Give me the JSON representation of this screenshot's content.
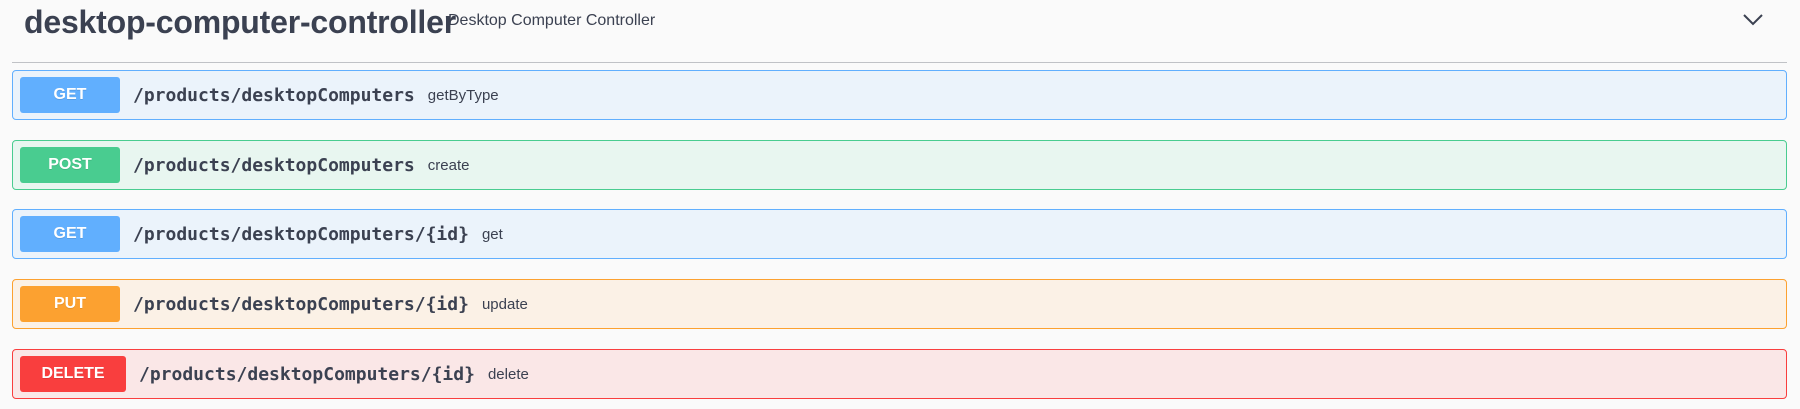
{
  "tag": {
    "name": "desktop-computer-controller",
    "description": "Desktop Computer Controller",
    "toggle_icon": "chevron-down-icon"
  },
  "operations": [
    {
      "method": "GET",
      "path": "/products/desktopComputers",
      "summary": "getByType"
    },
    {
      "method": "POST",
      "path": "/products/desktopComputers",
      "summary": "create"
    },
    {
      "method": "GET",
      "path": "/products/desktopComputers/{id}",
      "summary": "get"
    },
    {
      "method": "PUT",
      "path": "/products/desktopComputers/{id}",
      "summary": "update"
    },
    {
      "method": "DELETE",
      "path": "/products/desktopComputers/{id}",
      "summary": "delete"
    }
  ],
  "colors": {
    "text": "#3b4151",
    "get": "#61affe",
    "post": "#49cc90",
    "put": "#fca130",
    "delete": "#f93e3e"
  }
}
